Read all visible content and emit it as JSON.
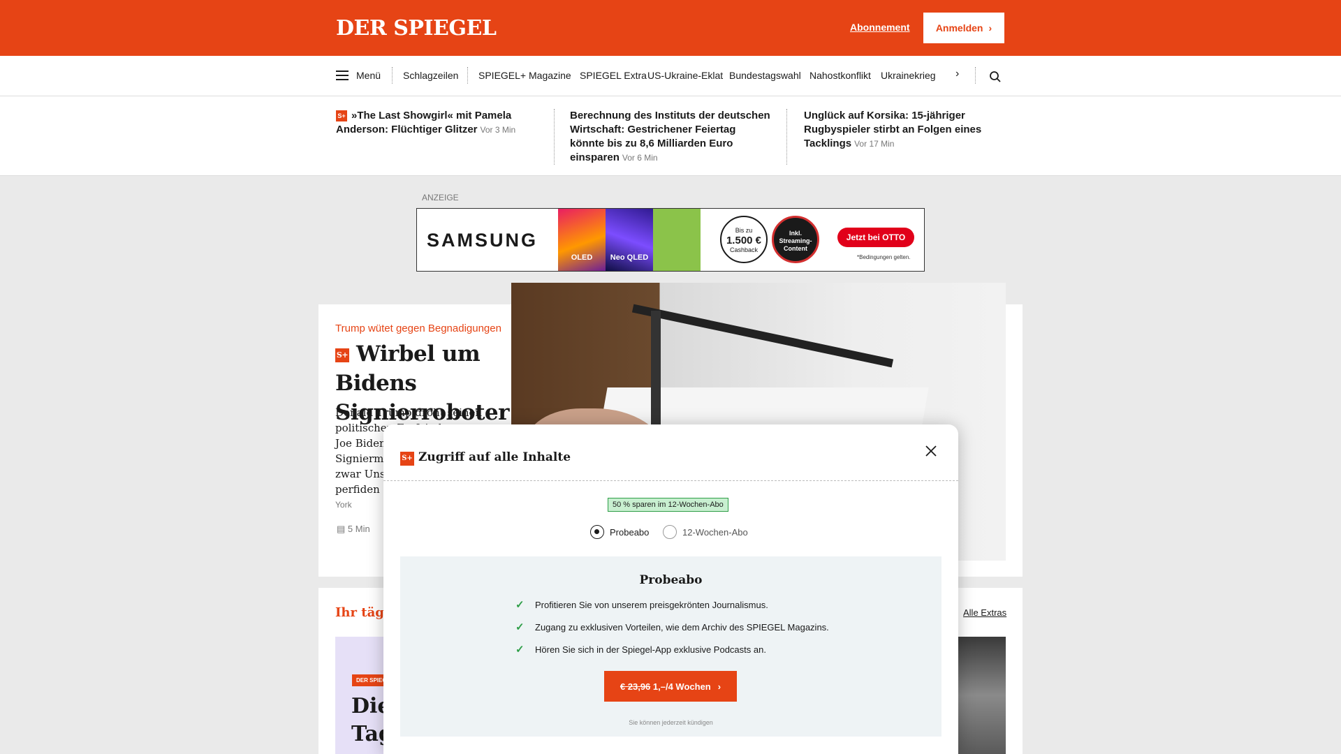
{
  "header": {
    "logo": "DER SPIEGEL",
    "abo_link": "Abonnement",
    "login_button": "Anmelden"
  },
  "nav": {
    "menu_label": "Menü",
    "items": [
      "Schlagzeilen",
      "SPIEGEL+",
      "Magazine",
      "SPIEGEL Extra",
      "US-Ukraine-Eklat",
      "Bundestagswahl",
      "Nahostkonflikt",
      "Ukrainekrieg"
    ]
  },
  "teasers": [
    {
      "title": "»The Last Showgirl« mit Pamela Anderson: Flüchtiger Glitzer",
      "time": "Vor 3 Min",
      "plus": true
    },
    {
      "title": "Berechnung des Instituts der deutschen Wirtschaft: Gestrichener Feiertag könnte bis zu 8,6 Milliarden Euro einsparen",
      "time": "Vor 6 Min",
      "plus": false
    },
    {
      "title": "Unglück auf Korsika: 15-jähriger Rugbyspieler stirbt an Folgen eines Tacklings",
      "time": "Vor 17 Min",
      "plus": false
    }
  ],
  "ad": {
    "label": "ANZEIGE",
    "brand": "SAMSUNG",
    "tv1": "OLED",
    "tv2": "Neo QLED",
    "cashback_top": "Bis zu",
    "cashback_amount": "1.500 €",
    "cashback_bottom": "Cashback",
    "streaming": "Inkl. Streaming-Content",
    "cta": "Jetzt bei OTTO",
    "fineprint": "*Bedingungen gelten."
  },
  "article": {
    "kicker": "Trump wütet gegen Begnadigungen",
    "headline": "Wirbel um Bidens Signierroboter",
    "lead": "Donald Trump droht seinen politischen Erzfeinden",
    "lead2": "Joe Biden",
    "lead3": "Signierma",
    "lead4": "zwar Unsi",
    "lead5": "perfiden K",
    "author": "York",
    "read_time": "5 Min"
  },
  "extras": {
    "title": "Ihr täglic",
    "all_link": "Alle Extras",
    "promo_tag": "DER SPIEGEL",
    "promo_title_1": "Die",
    "promo_title_2": "Tag"
  },
  "modal": {
    "title": "Zugriff auf alle Inhalte",
    "badge": "50 % sparen im 12-Wochen-Abo",
    "option_1": "Probeabo",
    "option_2": "12-Wochen-Abo",
    "selected_option": "Probeabo",
    "plan_title": "Probeabo",
    "benefits": [
      "Profitieren Sie von unserem preisgekrönten Journalismus.",
      "Zugang zu exklusiven Vorteilen, wie dem Archiv des SPIEGEL Magazins.",
      "Hören Sie sich in der Spiegel-App exklusive Podcasts an."
    ],
    "cta_old_price": "€ 23,96",
    "cta_new_price": "1,–/4 Wochen",
    "cancel_note": "Sie können jederzeit kündigen"
  },
  "colors": {
    "brand": "#e64415",
    "success": "#2e9e47"
  },
  "icons": [
    "menu-icon",
    "chevron-right-icon",
    "search-icon",
    "close-icon",
    "check-icon",
    "document-icon"
  ]
}
